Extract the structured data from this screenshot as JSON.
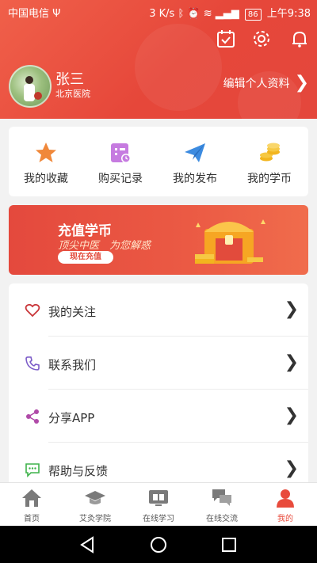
{
  "status_bar": {
    "carrier": "中国电信",
    "usb_symbol": "Ψ",
    "speed": "3 K/s",
    "battery": "86",
    "time": "上午9:38"
  },
  "header": {
    "icons": [
      "calendar-check-icon",
      "gear-icon",
      "bell-icon"
    ],
    "user_name": "张三",
    "hospital": "北京医院",
    "edit_profile": "编辑个人资料",
    "edit_chevron": "❯"
  },
  "quick_actions": [
    {
      "label": "我的收藏",
      "icon": "star-icon",
      "color": "#f0883a"
    },
    {
      "label": "购买记录",
      "icon": "purchase-record-icon",
      "color": "#c67be0"
    },
    {
      "label": "我的发布",
      "icon": "paper-plane-icon",
      "color": "#3c8be0"
    },
    {
      "label": "我的学币",
      "icon": "coins-icon",
      "color": "#f2b51e"
    }
  ],
  "banner": {
    "title": "充值学币",
    "subtitle": "顶尖中医　为您解惑",
    "button": "现在充值"
  },
  "menu": [
    {
      "label": "我的关注",
      "icon": "heart-icon",
      "color": "#c9363a",
      "arrow": "❯"
    },
    {
      "label": "联系我们",
      "icon": "phone-icon",
      "color": "#7c5cc8",
      "arrow": "❯"
    },
    {
      "label": "分享APP",
      "icon": "share-icon",
      "color": "#b04aa8",
      "arrow": "❯"
    },
    {
      "label": "帮助与反馈",
      "icon": "feedback-icon",
      "color": "#3fb34b",
      "arrow": "❯"
    }
  ],
  "tabs": [
    {
      "label": "首页",
      "icon": "home-icon",
      "active": false
    },
    {
      "label": "艾灸学院",
      "icon": "graduation-cap-icon",
      "active": false
    },
    {
      "label": "在线学习",
      "icon": "book-screen-icon",
      "active": false
    },
    {
      "label": "在线交流",
      "icon": "chat-bubbles-icon",
      "active": false
    },
    {
      "label": "我的",
      "icon": "person-icon",
      "active": true
    }
  ],
  "colors": {
    "brand": "#e84b3c",
    "header_bg": "#ec5646",
    "page_bg": "#f2f2f2"
  }
}
